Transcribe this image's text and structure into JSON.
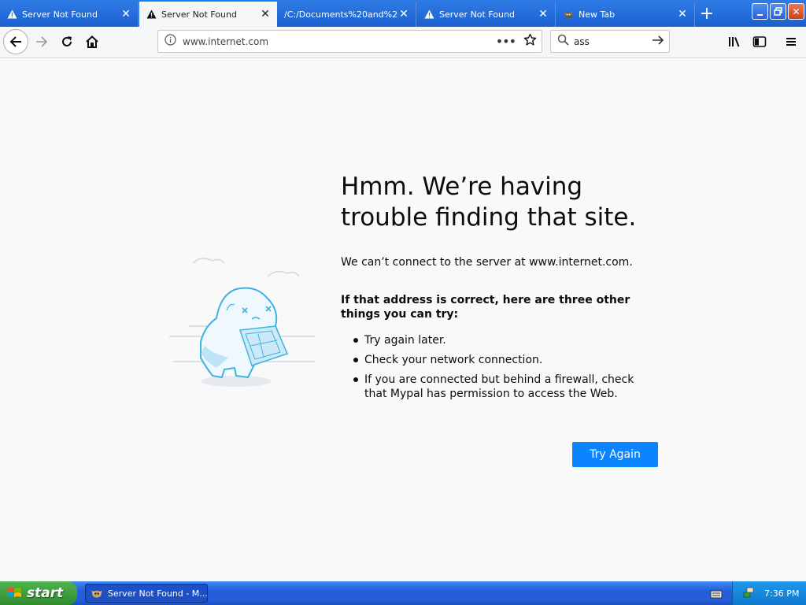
{
  "tabs": [
    {
      "title": "Server Not Found",
      "icon": "warning-icon",
      "active": false
    },
    {
      "title": "Server Not Found",
      "icon": "warning-icon",
      "active": true
    },
    {
      "title": "/C:/Documents%20and%20",
      "icon": "",
      "active": false
    },
    {
      "title": "Server Not Found",
      "icon": "warning-icon",
      "active": false
    },
    {
      "title": "New Tab",
      "icon": "mypal-icon",
      "active": false
    }
  ],
  "window_controls": {
    "minimize": "minimize-icon",
    "maximize": "restore-icon",
    "close": "close-icon"
  },
  "navbar": {
    "url": "www.internet.com",
    "search_value": "ass"
  },
  "error_page": {
    "title": "Hmm. We’re having trouble finding that site.",
    "description": "We can’t connect to the server at www.internet.com.",
    "subhead": "If that address is correct, here are three other things you can try:",
    "suggestions": [
      "Try again later.",
      "Check your network connection.",
      "If you are connected but behind a firewall, check that Mypal has permission to access the Web."
    ],
    "try_again_label": "Try Again"
  },
  "taskbar": {
    "start_label": "start",
    "window_label": "Server Not Found - M...",
    "clock": "7:36 PM"
  },
  "colors": {
    "accent": "#0a84ff",
    "taskbar": "#245edb",
    "start": "#3a9b3a"
  }
}
